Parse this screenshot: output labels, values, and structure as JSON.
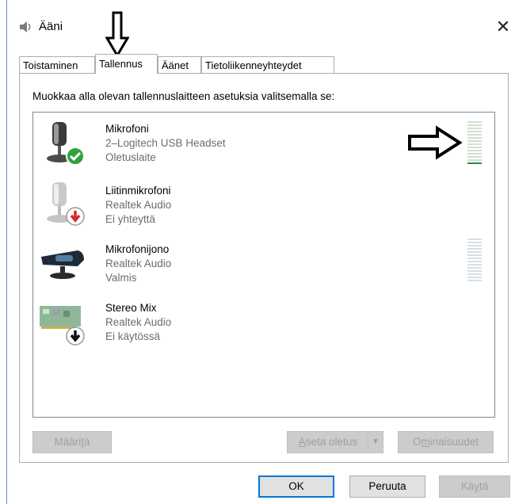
{
  "window": {
    "title": "Ääni",
    "close_glyph": "✕"
  },
  "tabs": [
    {
      "label": "Toistaminen",
      "active": false
    },
    {
      "label": "Tallennus",
      "active": true
    },
    {
      "label": "Äänet",
      "active": false
    },
    {
      "label": "Tietoliikenneyhteydet",
      "active": false
    }
  ],
  "instruction": "Muokkaa alla olevan tallennuslaitteen asetuksia valitsemalla se:",
  "devices": [
    {
      "name": "Mikrofoni",
      "device": "2–Logitech USB Headset",
      "status": "Oletuslaite",
      "icon": "microphone-default-icon",
      "level": 0.1
    },
    {
      "name": "Liitinmikrofoni",
      "device": "Realtek Audio",
      "status": "Ei yhteyttä",
      "icon": "microphone-disconnected-icon"
    },
    {
      "name": "Mikrofonijono",
      "device": "Realtek Audio",
      "status": "Valmis",
      "icon": "microphone-array-icon",
      "level": 0
    },
    {
      "name": "Stereo Mix",
      "device": "Realtek Audio",
      "status": "Ei käytössä",
      "icon": "stereo-mix-disabled-icon"
    }
  ],
  "buttons": {
    "configure": {
      "pre": "Määri",
      "ul": "t",
      "post": "ä",
      "enabled": false
    },
    "set_default": {
      "pre": "",
      "ul": "A",
      "post": "seta oletus",
      "enabled": false
    },
    "properties": {
      "pre": "O",
      "ul": "m",
      "post": "inaisuudet",
      "enabled": false
    },
    "ok": {
      "label": "OK"
    },
    "cancel": {
      "label": "Peruuta"
    },
    "apply": {
      "pre": "Kä",
      "ul": "y",
      "post": "tä",
      "enabled": false
    }
  },
  "colors": {
    "accent": "#0078d7",
    "level": "#2e8b3a",
    "default_badge": "#2fa33a",
    "disconnected_badge": "#d9262b"
  }
}
